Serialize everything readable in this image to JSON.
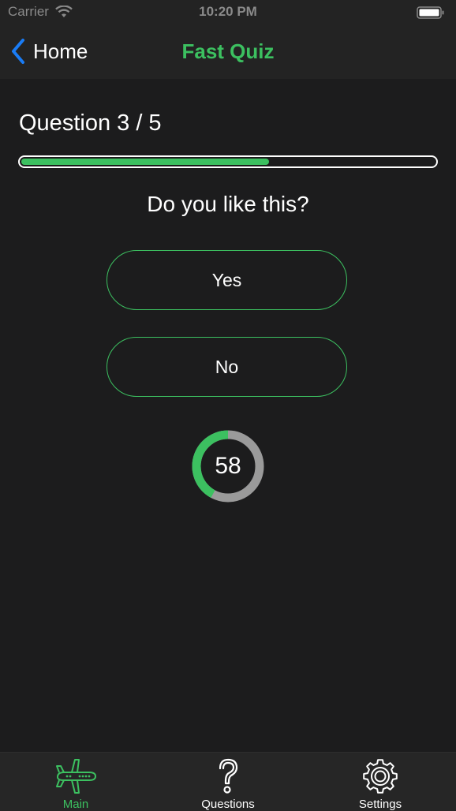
{
  "status_bar": {
    "carrier": "Carrier",
    "time": "10:20 PM",
    "wifi_icon": "wifi-icon",
    "battery_icon": "battery-icon"
  },
  "nav": {
    "back_label": "Home",
    "back_icon": "chevron-left-icon",
    "title": "Fast Quiz"
  },
  "quiz": {
    "question_number": "Question 3 / 5",
    "progress_fraction": 0.6,
    "question_text": "Do you like this?",
    "answers": [
      {
        "label": "Yes"
      },
      {
        "label": "No"
      }
    ],
    "timer_value": "58",
    "timer_fraction": 0.42
  },
  "tab_bar": {
    "items": [
      {
        "label": "Main",
        "icon": "airplane-icon",
        "selected": true
      },
      {
        "label": "Questions",
        "icon": "question-icon",
        "selected": false
      },
      {
        "label": "Settings",
        "icon": "gear-icon",
        "selected": false
      }
    ]
  },
  "colors": {
    "accent": "#3cc060",
    "background": "#1c1c1d",
    "bar_background": "#232323",
    "back_blue": "#1a7cf5",
    "timer_track": "#9a9a9a"
  }
}
